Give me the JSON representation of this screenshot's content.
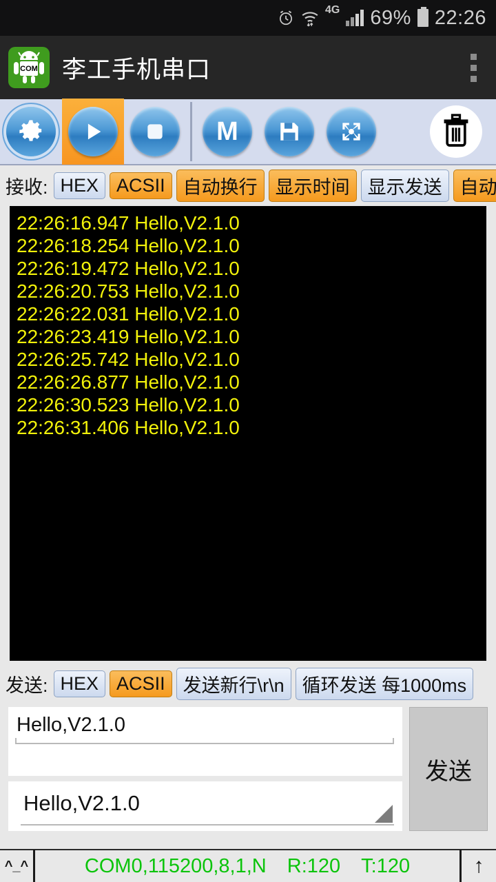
{
  "system_bar": {
    "icons": [
      "alarm-icon",
      "wifi-icon",
      "signal-icon",
      "battery-icon"
    ],
    "network": "4G",
    "battery_percent": "69%",
    "clock": "22:26"
  },
  "action_bar": {
    "app_icon_label": "COM",
    "title": "李工手机串口",
    "overflow_label": "overflow-menu"
  },
  "toolbar": {
    "buttons": [
      {
        "name": "settings-button",
        "icon": "gear-icon",
        "glyph": "",
        "active": false
      },
      {
        "name": "start-button",
        "icon": "play-icon",
        "glyph": "",
        "active": true
      },
      {
        "name": "stop-button",
        "icon": "stop-icon",
        "glyph": "",
        "active": false
      },
      {
        "name": "macro-button",
        "icon": "m-icon",
        "glyph": "M",
        "active": false
      },
      {
        "name": "save-button",
        "icon": "floppy-disk-icon",
        "glyph": "",
        "active": false
      },
      {
        "name": "expand-button",
        "icon": "four-way-arrows-icon",
        "glyph": "",
        "active": false
      }
    ],
    "clear_button": {
      "name": "clear-button",
      "icon": "trash-icon"
    }
  },
  "receive_bar": {
    "label": "接收:",
    "toggles": [
      {
        "label": "HEX",
        "active": false
      },
      {
        "label": "ACSII",
        "active": true
      },
      {
        "label": "自动换行",
        "active": true
      },
      {
        "label": "显示时间",
        "active": true
      },
      {
        "label": "显示发送",
        "active": false
      },
      {
        "label": "自动滚屏",
        "active": true
      }
    ]
  },
  "terminal": {
    "lines": [
      "22:26:16.947 Hello,V2.1.0",
      "22:26:18.254 Hello,V2.1.0",
      "22:26:19.472 Hello,V2.1.0",
      "22:26:20.753 Hello,V2.1.0",
      "22:26:22.031 Hello,V2.1.0",
      "22:26:23.419 Hello,V2.1.0",
      "22:26:25.742 Hello,V2.1.0",
      "22:26:26.877 Hello,V2.1.0",
      "22:26:30.523 Hello,V2.1.0",
      "22:26:31.406 Hello,V2.1.0"
    ],
    "text_color": "#f2f20a",
    "background_color": "#000000"
  },
  "send_bar": {
    "label": "发送:",
    "toggles": [
      {
        "label": "HEX",
        "active": false
      },
      {
        "label": "ACSII",
        "active": true
      },
      {
        "label": "发送新行\\r\\n",
        "active": false
      },
      {
        "label": "循环发送 每1000ms",
        "active": false
      }
    ]
  },
  "send_area": {
    "input_value": "Hello,V2.1.0",
    "input_placeholder": "",
    "history_value": "Hello,V2.1.0",
    "send_button_label": "发送"
  },
  "status_bar": {
    "face": "^_^",
    "port_info": "COM0,115200,8,1,N",
    "rx": "R:120",
    "tx": "T:120",
    "scroll_indicator": "↑",
    "text_color": "#0bc40b"
  }
}
